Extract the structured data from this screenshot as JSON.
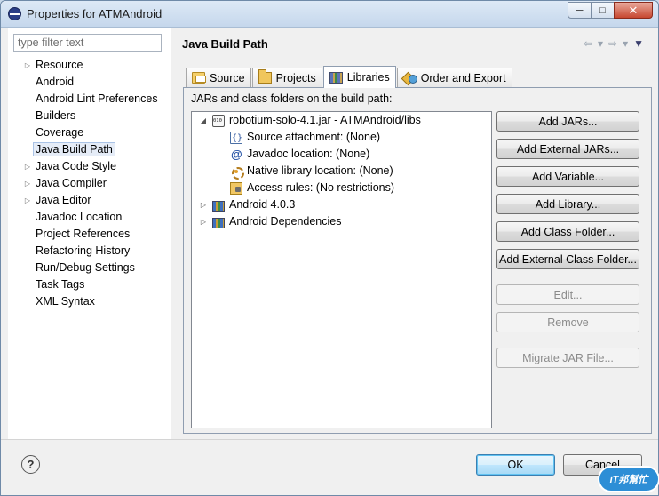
{
  "window": {
    "title": "Properties for ATMAndroid",
    "controls": [
      "minimize",
      "maximize",
      "close"
    ]
  },
  "sidebar": {
    "filter_placeholder": "type filter text",
    "items": [
      {
        "label": "Resource",
        "expandable": true
      },
      {
        "label": "Android",
        "expandable": false
      },
      {
        "label": "Android Lint Preferences",
        "expandable": false
      },
      {
        "label": "Builders",
        "expandable": false
      },
      {
        "label": "Coverage",
        "expandable": false
      },
      {
        "label": "Java Build Path",
        "expandable": false,
        "selected": true
      },
      {
        "label": "Java Code Style",
        "expandable": true
      },
      {
        "label": "Java Compiler",
        "expandable": true
      },
      {
        "label": "Java Editor",
        "expandable": true
      },
      {
        "label": "Javadoc Location",
        "expandable": false
      },
      {
        "label": "Project References",
        "expandable": false
      },
      {
        "label": "Refactoring History",
        "expandable": false
      },
      {
        "label": "Run/Debug Settings",
        "expandable": false
      },
      {
        "label": "Task Tags",
        "expandable": false
      },
      {
        "label": "XML Syntax",
        "expandable": false
      }
    ]
  },
  "main": {
    "title": "Java Build Path",
    "tabs": [
      {
        "label": "Source",
        "icon": "source-folder-icon"
      },
      {
        "label": "Projects",
        "icon": "project-icon"
      },
      {
        "label": "Libraries",
        "icon": "libraries-icon",
        "active": true
      },
      {
        "label": "Order and Export",
        "icon": "order-export-icon"
      }
    ],
    "section_label": "JARs and class folders on the build path:",
    "tree": {
      "jar": "robotium-solo-4.1.jar - ATMAndroid/libs",
      "children": [
        "Source attachment: (None)",
        "Javadoc location: (None)",
        "Native library location: (None)",
        "Access rules: (No restrictions)"
      ],
      "libraries": [
        "Android 4.0.3",
        "Android Dependencies"
      ]
    },
    "buttons": {
      "add_jars": "Add JARs...",
      "add_external_jars": "Add External JARs...",
      "add_variable": "Add Variable...",
      "add_library": "Add Library...",
      "add_class_folder": "Add Class Folder...",
      "add_external_class_folder": "Add External Class Folder...",
      "edit": "Edit...",
      "remove": "Remove",
      "migrate_jar": "Migrate JAR File..."
    }
  },
  "footer": {
    "help": "?",
    "ok": "OK",
    "cancel": "Cancel",
    "watermark": "iT邦幫忙"
  }
}
